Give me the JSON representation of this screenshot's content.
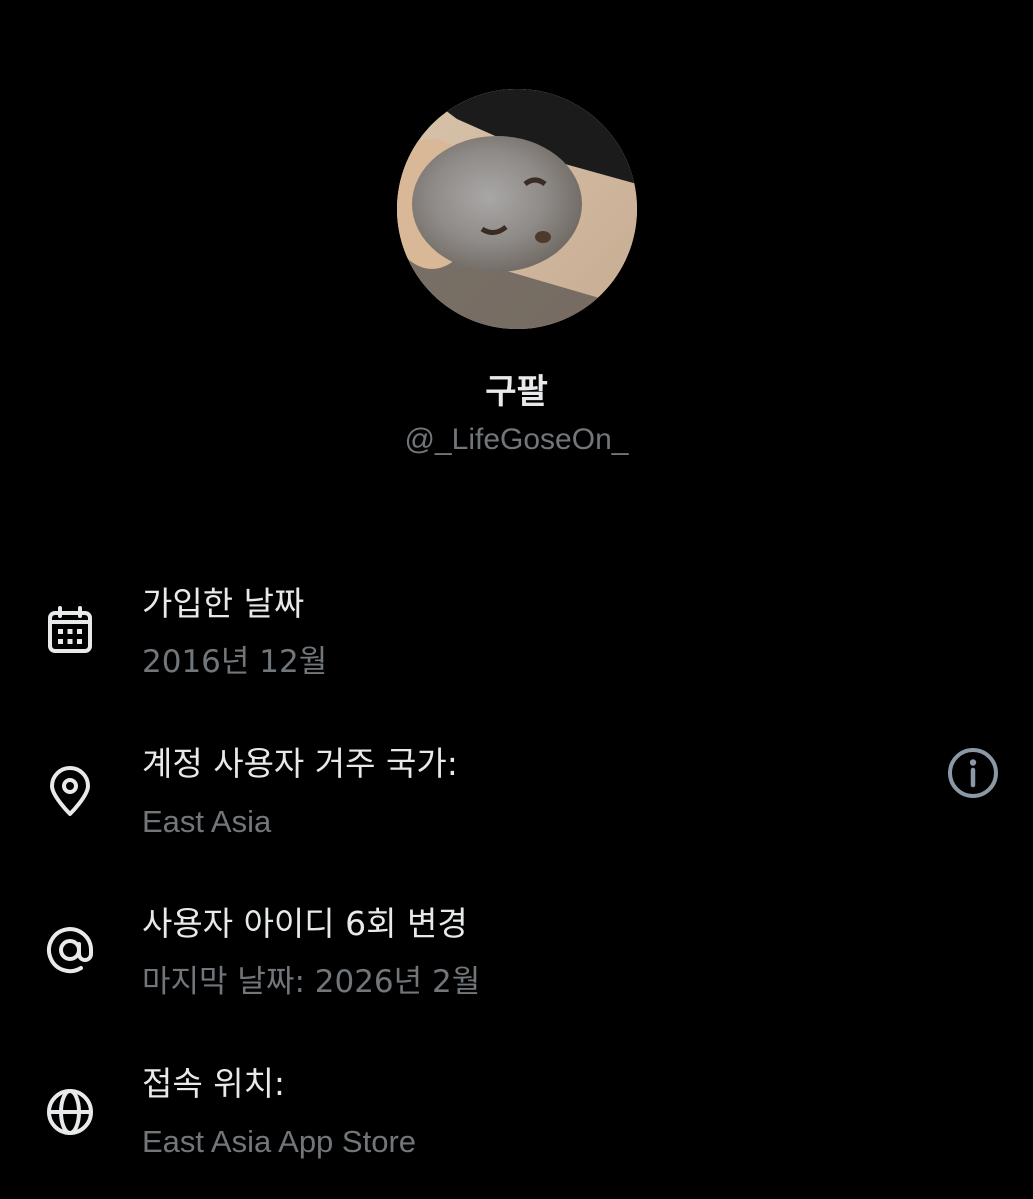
{
  "profile": {
    "display_name": "구팔",
    "handle": "@_LifeGoseOn_"
  },
  "rows": [
    {
      "icon": "calendar-icon",
      "title": "가입한 날짜",
      "subtitle": "2016년 12월"
    },
    {
      "icon": "location-pin-icon",
      "title": "계정 사용자 거주 국가:",
      "subtitle": "East Asia",
      "action_icon": "info-icon"
    },
    {
      "icon": "at-sign-icon",
      "title": "사용자 아이디 6회 변경",
      "subtitle": "마지막 날짜: 2026년 2월"
    },
    {
      "icon": "globe-icon",
      "title": "접속 위치:",
      "subtitle": "East Asia App Store"
    }
  ],
  "colors": {
    "background": "#000000",
    "primary_text": "#e7e9ea",
    "secondary_text": "#71767b",
    "icon": "#e7e9ea",
    "info_icon": "#8b98a5"
  }
}
